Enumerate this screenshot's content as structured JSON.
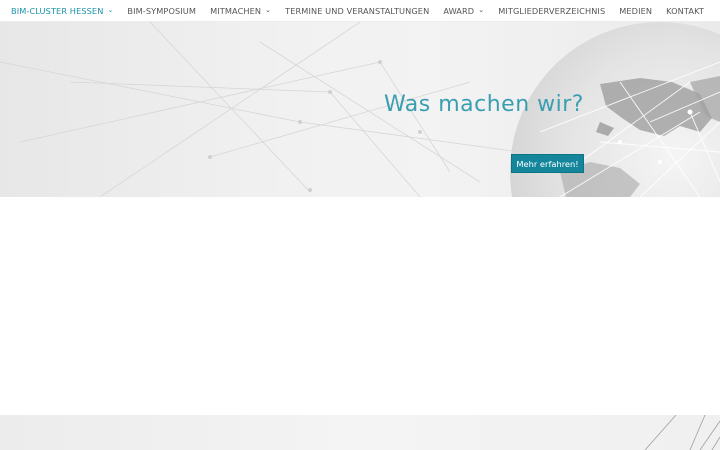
{
  "nav": {
    "items": [
      {
        "label": "BIM-CLUSTER HESSEN",
        "dropdown": true,
        "active": true
      },
      {
        "label": "BIM-SYMPOSIUM",
        "dropdown": false,
        "active": false
      },
      {
        "label": "MITMACHEN",
        "dropdown": true,
        "active": false
      },
      {
        "label": "TERMINE UND VERANSTALTUNGEN",
        "dropdown": false,
        "active": false
      },
      {
        "label": "AWARD",
        "dropdown": true,
        "active": false
      },
      {
        "label": "MITGLIEDERVERZEICHNIS",
        "dropdown": false,
        "active": false
      },
      {
        "label": "MEDIEN",
        "dropdown": false,
        "active": false
      },
      {
        "label": "KONTAKT",
        "dropdown": false,
        "active": false
      }
    ],
    "chevron_icon": "chevron-down-icon"
  },
  "hero": {
    "title": "Was machen wir?",
    "button_label": "Mehr erfahren!",
    "background": "network-globe-image"
  },
  "colors": {
    "accent": "#1a94a8",
    "title": "#3a9eb1",
    "button_bg": "#14869b",
    "nav_text": "#555555"
  }
}
